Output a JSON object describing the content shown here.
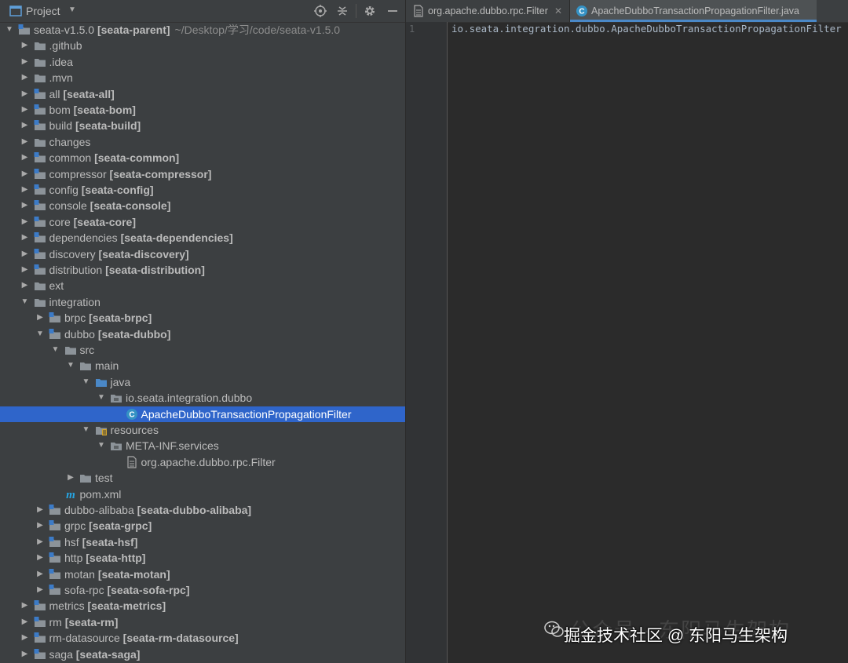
{
  "panel": {
    "title": "Project"
  },
  "tree": [
    {
      "depth": 0,
      "kind": "module",
      "open": true,
      "name": "seata-v1.5.0",
      "module": "[seata-parent]",
      "path": "~/Desktop/学习/code/seata-v1.5.0"
    },
    {
      "depth": 1,
      "kind": "folder",
      "open": false,
      "name": ".github"
    },
    {
      "depth": 1,
      "kind": "folder",
      "open": false,
      "name": ".idea"
    },
    {
      "depth": 1,
      "kind": "folder",
      "open": false,
      "name": ".mvn"
    },
    {
      "depth": 1,
      "kind": "module",
      "open": false,
      "name": "all",
      "module": "[seata-all]"
    },
    {
      "depth": 1,
      "kind": "module",
      "open": false,
      "name": "bom",
      "module": "[seata-bom]"
    },
    {
      "depth": 1,
      "kind": "module",
      "open": false,
      "name": "build",
      "module": "[seata-build]"
    },
    {
      "depth": 1,
      "kind": "folder",
      "open": false,
      "name": "changes"
    },
    {
      "depth": 1,
      "kind": "module",
      "open": false,
      "name": "common",
      "module": "[seata-common]"
    },
    {
      "depth": 1,
      "kind": "module",
      "open": false,
      "name": "compressor",
      "module": "[seata-compressor]"
    },
    {
      "depth": 1,
      "kind": "module",
      "open": false,
      "name": "config",
      "module": "[seata-config]"
    },
    {
      "depth": 1,
      "kind": "module",
      "open": false,
      "name": "console",
      "module": "[seata-console]"
    },
    {
      "depth": 1,
      "kind": "module",
      "open": false,
      "name": "core",
      "module": "[seata-core]"
    },
    {
      "depth": 1,
      "kind": "module",
      "open": false,
      "name": "dependencies",
      "module": "[seata-dependencies]"
    },
    {
      "depth": 1,
      "kind": "module",
      "open": false,
      "name": "discovery",
      "module": "[seata-discovery]"
    },
    {
      "depth": 1,
      "kind": "module",
      "open": false,
      "name": "distribution",
      "module": "[seata-distribution]"
    },
    {
      "depth": 1,
      "kind": "folder",
      "open": false,
      "name": "ext"
    },
    {
      "depth": 1,
      "kind": "folder",
      "open": true,
      "name": "integration"
    },
    {
      "depth": 2,
      "kind": "module",
      "open": false,
      "name": "brpc",
      "module": "[seata-brpc]"
    },
    {
      "depth": 2,
      "kind": "module",
      "open": true,
      "name": "dubbo",
      "module": "[seata-dubbo]"
    },
    {
      "depth": 3,
      "kind": "folder",
      "open": true,
      "name": "src"
    },
    {
      "depth": 4,
      "kind": "folder",
      "open": true,
      "name": "main"
    },
    {
      "depth": 5,
      "kind": "source",
      "open": true,
      "name": "java"
    },
    {
      "depth": 6,
      "kind": "package",
      "open": true,
      "name": "io.seata.integration.dubbo"
    },
    {
      "depth": 7,
      "kind": "class",
      "name": "ApacheDubboTransactionPropagationFilter",
      "selected": true
    },
    {
      "depth": 5,
      "kind": "resources",
      "open": true,
      "name": "resources"
    },
    {
      "depth": 6,
      "kind": "package",
      "open": true,
      "name": "META-INF.services"
    },
    {
      "depth": 7,
      "kind": "file",
      "name": "org.apache.dubbo.rpc.Filter"
    },
    {
      "depth": 4,
      "kind": "folder",
      "open": false,
      "name": "test"
    },
    {
      "depth": 3,
      "kind": "maven",
      "name": "pom.xml"
    },
    {
      "depth": 2,
      "kind": "module",
      "open": false,
      "name": "dubbo-alibaba",
      "module": "[seata-dubbo-alibaba]"
    },
    {
      "depth": 2,
      "kind": "module",
      "open": false,
      "name": "grpc",
      "module": "[seata-grpc]"
    },
    {
      "depth": 2,
      "kind": "module",
      "open": false,
      "name": "hsf",
      "module": "[seata-hsf]"
    },
    {
      "depth": 2,
      "kind": "module",
      "open": false,
      "name": "http",
      "module": "[seata-http]"
    },
    {
      "depth": 2,
      "kind": "module",
      "open": false,
      "name": "motan",
      "module": "[seata-motan]"
    },
    {
      "depth": 2,
      "kind": "module",
      "open": false,
      "name": "sofa-rpc",
      "module": "[seata-sofa-rpc]"
    },
    {
      "depth": 1,
      "kind": "module",
      "open": false,
      "name": "metrics",
      "module": "[seata-metrics]"
    },
    {
      "depth": 1,
      "kind": "module",
      "open": false,
      "name": "rm",
      "module": "[seata-rm]"
    },
    {
      "depth": 1,
      "kind": "module",
      "open": false,
      "name": "rm-datasource",
      "module": "[seata-rm-datasource]"
    },
    {
      "depth": 1,
      "kind": "module",
      "open": false,
      "name": "saga",
      "module": "[seata-saga]"
    }
  ],
  "editor": {
    "tabs": [
      {
        "label": "org.apache.dubbo.rpc.Filter",
        "icon": "text-file-icon",
        "active": false
      },
      {
        "label": "ApacheDubboTransactionPropagationFilter.java",
        "icon": "java-class-icon",
        "active": true
      }
    ],
    "line_number": "1",
    "code": "io.seata.integration.dubbo.ApacheDubboTransactionPropagationFilter"
  },
  "watermark": {
    "text": "掘金技术社区 @ 东阳马生架构",
    "ghost": "公众号 · 东阳马生架构"
  },
  "colors": {
    "panel_bg": "#3c3f41",
    "editor_bg": "#2b2b2b",
    "selection": "#2f65ca",
    "folder": "#8c9399",
    "module_badge": "#3c7bc7",
    "source_folder": "#4a88c7",
    "class_icon": "#3592c4",
    "maven": "#26a5e2",
    "resources_badge": "#d4a52c"
  }
}
